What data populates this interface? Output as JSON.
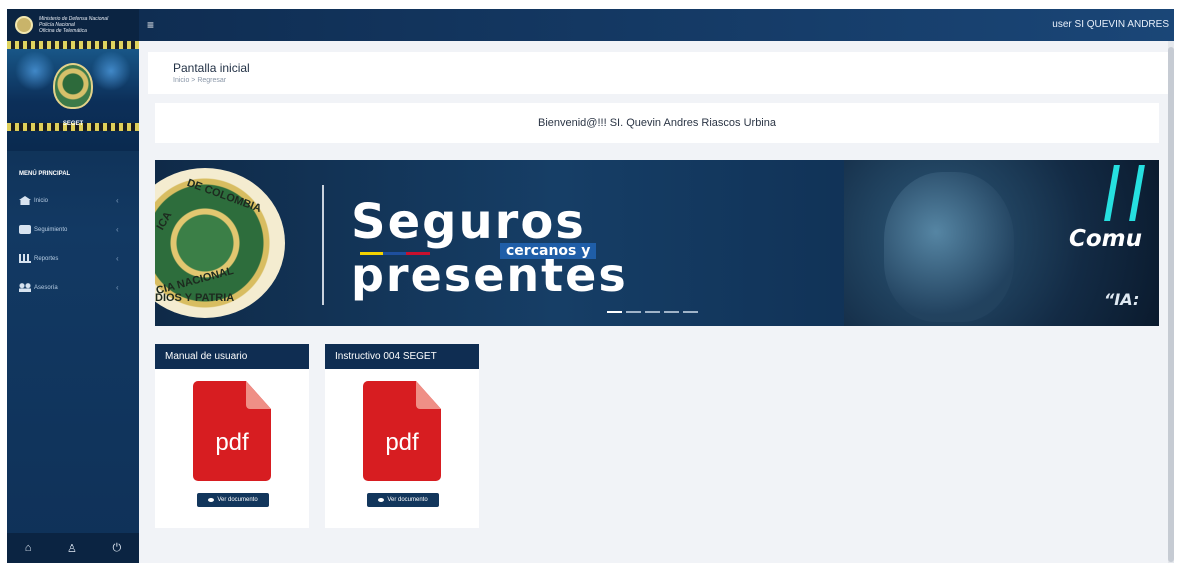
{
  "brand": {
    "line1": "Ministerio de Defensa Nacional",
    "line2": "Policía Nacional",
    "line3": "Oficina de Telemática"
  },
  "sidebar": {
    "banner_label": "SEGET",
    "menu_title": "MENÚ PRINCIPAL",
    "items": [
      {
        "label": "Inicio",
        "icon": "home-icon"
      },
      {
        "label": "Seguimiento",
        "icon": "camera-icon"
      },
      {
        "label": "Reportes",
        "icon": "chart-icon"
      },
      {
        "label": "Asesoría",
        "icon": "people-icon"
      }
    ],
    "chevron": "‹",
    "footer": {
      "home": "⌂",
      "user": "♙",
      "power": "⏻"
    }
  },
  "topbar": {
    "menu": "≡",
    "user": "user SI QUEVIN ANDRES"
  },
  "page": {
    "title": "Pantalla inicial",
    "crumb_home": "Inicio",
    "crumb_sep": ">",
    "crumb_back": "Regresar"
  },
  "welcome": "Bienvenid@!!! SI. Quevin Andres Riascos Urbina",
  "carousel": {
    "crest_top": "DE COLOMBIA",
    "crest_left": "ICA",
    "crest_bottom": "CIA NACIONAL",
    "crest_motto": "DIOS Y PATRIA",
    "slogan1": "Seguros",
    "slogan2": "cercanos y",
    "slogan3": "presentes",
    "side_title": "Comu",
    "side_quote": "“IA:"
  },
  "documents": [
    {
      "title": "Manual de usuario",
      "icon_label": "pdf",
      "button": "Ver documento"
    },
    {
      "title": "Instructivo 004 SEGET",
      "icon_label": "pdf",
      "button": "Ver documento"
    }
  ]
}
